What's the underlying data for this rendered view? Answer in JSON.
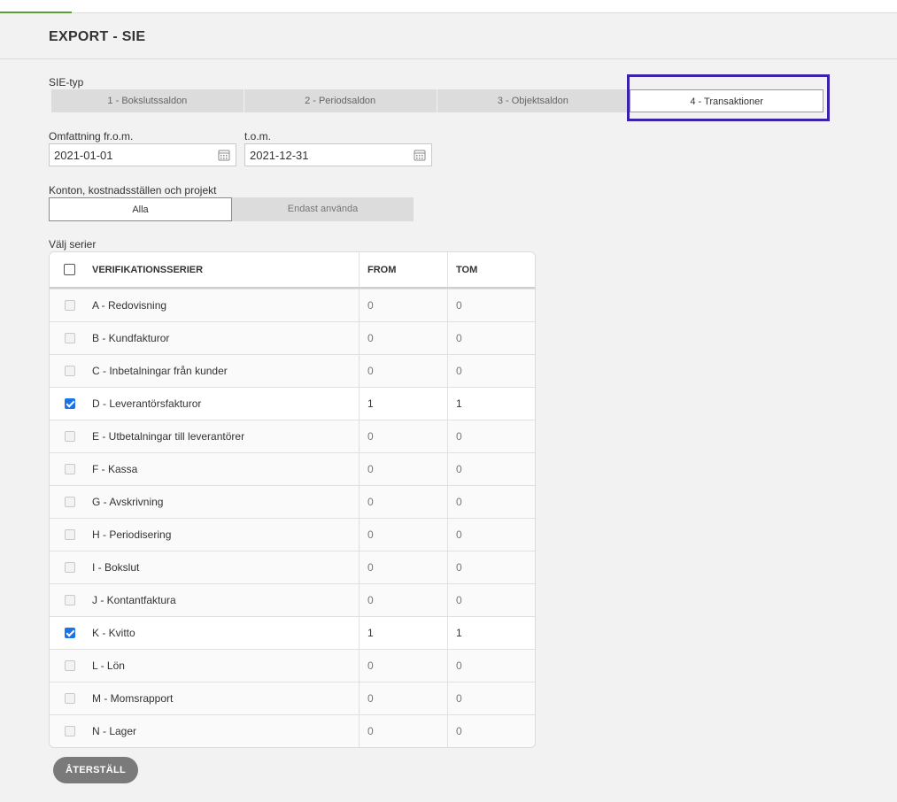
{
  "header": {
    "title": "EXPORT - SIE"
  },
  "sie_type": {
    "label": "SIE-typ",
    "options": [
      "1 - Bokslutssaldon",
      "2 - Periodsaldon",
      "3 - Objektsaldon",
      "4 - Transaktioner"
    ],
    "selected": "4 - Transaktioner"
  },
  "range": {
    "from_label": "Omfattning fr.o.m.",
    "from_value": "2021-01-01",
    "to_label": "t.o.m.",
    "to_value": "2021-12-31"
  },
  "scope": {
    "label": "Konton, kostnadsställen och projekt",
    "options": [
      "Alla",
      "Endast använda"
    ],
    "selected": "Alla"
  },
  "series": {
    "label": "Välj serier",
    "columns": [
      "VERIFIKATIONSSERIER",
      "FROM",
      "TOM"
    ],
    "rows": [
      {
        "name": "A - Redovisning",
        "from": "0",
        "tom": "0",
        "checked": false
      },
      {
        "name": "B - Kundfakturor",
        "from": "0",
        "tom": "0",
        "checked": false
      },
      {
        "name": "C - Inbetalningar från kunder",
        "from": "0",
        "tom": "0",
        "checked": false
      },
      {
        "name": "D - Leverantörsfakturor",
        "from": "1",
        "tom": "1",
        "checked": true
      },
      {
        "name": "E - Utbetalningar till leverantörer",
        "from": "0",
        "tom": "0",
        "checked": false
      },
      {
        "name": "F - Kassa",
        "from": "0",
        "tom": "0",
        "checked": false
      },
      {
        "name": "G - Avskrivning",
        "from": "0",
        "tom": "0",
        "checked": false
      },
      {
        "name": "H - Periodisering",
        "from": "0",
        "tom": "0",
        "checked": false
      },
      {
        "name": "I - Bokslut",
        "from": "0",
        "tom": "0",
        "checked": false
      },
      {
        "name": "J - Kontantfaktura",
        "from": "0",
        "tom": "0",
        "checked": false
      },
      {
        "name": "K - Kvitto",
        "from": "1",
        "tom": "1",
        "checked": true
      },
      {
        "name": "L - Lön",
        "from": "0",
        "tom": "0",
        "checked": false
      },
      {
        "name": "M - Momsrapport",
        "from": "0",
        "tom": "0",
        "checked": false
      },
      {
        "name": "N - Lager",
        "from": "0",
        "tom": "0",
        "checked": false
      }
    ]
  },
  "actions": {
    "reset_label": "ÅTERSTÄLL"
  },
  "colors": {
    "accent": "#5a9e3b",
    "highlight": "#3b22a8",
    "checkbox": "#1a73e8",
    "reset": "#7a7a7a"
  }
}
